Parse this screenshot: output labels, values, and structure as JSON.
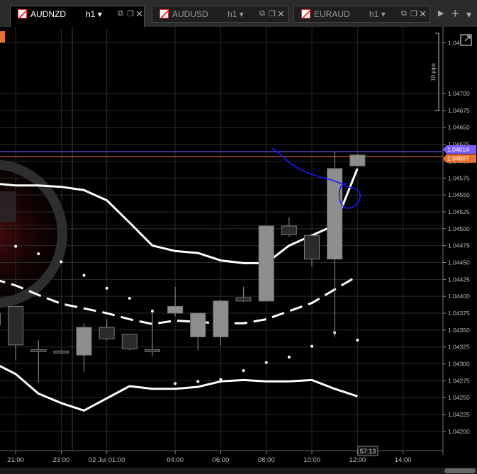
{
  "tabs": [
    {
      "symbol": "AUDNZD",
      "timeframe": "h1",
      "active": true
    },
    {
      "symbol": "AUDUSD",
      "timeframe": "h1",
      "active": false
    },
    {
      "symbol": "EURAUD",
      "timeframe": "h1",
      "active": false
    }
  ],
  "icons": {
    "dropdown": "chevron-down-icon",
    "popout": "popout-icon",
    "detach": "detach-icon",
    "close": "close-icon",
    "scroll_right": "scroll-right-icon",
    "add_tab": "plus-icon",
    "expand": "expand-icon"
  },
  "price_axis": {
    "labels": [
      "1.04775",
      "1.04700",
      "1.04675",
      "1.04650",
      "1.04625",
      "1.04600",
      "1.04575",
      "1.04550",
      "1.04525",
      "1.04500",
      "1.04475",
      "1.04450",
      "1.04425",
      "1.04400",
      "1.04375",
      "1.04350",
      "1.04325",
      "1.04300",
      "1.04275",
      "1.04250",
      "1.04225",
      "1.04200"
    ],
    "markers": {
      "bid": "1.04614",
      "ask": "1.04607"
    },
    "pips_label": "10 pips"
  },
  "time_axis": {
    "labels": [
      "21:00",
      "23:00",
      "02 Jul 01:00",
      "04:00",
      "06:00",
      "08:00",
      "10:00",
      "12:00",
      "14:00"
    ]
  },
  "countdown": "57:13",
  "colors": {
    "bull": "#8e8e8e",
    "bear": "#2b2b2b",
    "band": "#ffffff",
    "annotation": "#1a1aff",
    "ask_line": "#e8722f",
    "bid_line": "#7b5cff",
    "grid": "#2a2a2a"
  },
  "chart_data": {
    "type": "candlestick",
    "symbol": "AUDNZD",
    "timeframe": "h1",
    "ylim": [
      1.0418,
      1.04786
    ],
    "bar_start_hour": 20,
    "candles": [
      {
        "o": 1.04375,
        "h": 1.04398,
        "l": 1.0434,
        "c": 1.04358
      },
      {
        "o": 1.04385,
        "h": 1.04385,
        "l": 1.04305,
        "c": 1.04328
      },
      {
        "o": 1.04321,
        "h": 1.04335,
        "l": 1.04272,
        "c": 1.04318
      },
      {
        "o": 1.04319,
        "h": 1.04321,
        "l": 1.04315,
        "c": 1.04316
      },
      {
        "o": 1.04313,
        "h": 1.0436,
        "l": 1.04288,
        "c": 1.04354
      },
      {
        "o": 1.04354,
        "h": 1.04366,
        "l": 1.04335,
        "c": 1.04337
      },
      {
        "o": 1.04344,
        "h": 1.04344,
        "l": 1.0432,
        "c": 1.04322
      },
      {
        "o": 1.04321,
        "h": 1.04376,
        "l": 1.04311,
        "c": 1.04318
      },
      {
        "o": 1.04375,
        "h": 1.04414,
        "l": 1.0437,
        "c": 1.04385
      },
      {
        "o": 1.0434,
        "h": 1.04375,
        "l": 1.0432,
        "c": 1.04375
      },
      {
        "o": 1.0434,
        "h": 1.04395,
        "l": 1.04327,
        "c": 1.04393
      },
      {
        "o": 1.04398,
        "h": 1.04414,
        "l": 1.04392,
        "c": 1.04393
      },
      {
        "o": 1.04393,
        "h": 1.04504,
        "l": 1.04393,
        "c": 1.04504
      },
      {
        "o": 1.04504,
        "h": 1.04517,
        "l": 1.04488,
        "c": 1.04491
      },
      {
        "o": 1.0449,
        "h": 1.0449,
        "l": 1.04444,
        "c": 1.04455
      },
      {
        "o": 1.04455,
        "h": 1.04614,
        "l": 1.0434,
        "c": 1.04589
      },
      {
        "o": 1.04593,
        "h": 1.04611,
        "l": 1.04593,
        "c": 1.04609
      }
    ],
    "upper_band": [
      1.04567,
      1.04564,
      1.04564,
      1.04562,
      1.04557,
      1.04542,
      1.04509,
      1.04475,
      1.04467,
      1.04464,
      1.04453,
      1.04449,
      1.04449,
      1.04475,
      1.0449,
      1.04505,
      1.04589
    ],
    "middle_band": [
      1.04426,
      1.04416,
      1.04402,
      1.04389,
      1.04382,
      1.04375,
      1.04366,
      1.04359,
      1.04364,
      1.04362,
      1.0436,
      1.0436,
      1.04366,
      1.04378,
      1.0439,
      1.0441,
      1.0443
    ],
    "lower_band": [
      1.04302,
      1.04285,
      1.04256,
      1.04242,
      1.04231,
      1.04249,
      1.04267,
      1.04263,
      1.04263,
      1.04266,
      1.04274,
      1.04276,
      1.04274,
      1.04274,
      1.04276,
      1.04263,
      1.04252
    ],
    "sar_dots": [
      1.04485,
      1.04474,
      1.04463,
      1.04451,
      1.04431,
      1.04412,
      1.04397,
      1.04378,
      1.04271,
      1.04274,
      1.04277,
      1.0429,
      1.04302,
      1.0431,
      1.04326,
      1.04346,
      1.04335
    ]
  }
}
